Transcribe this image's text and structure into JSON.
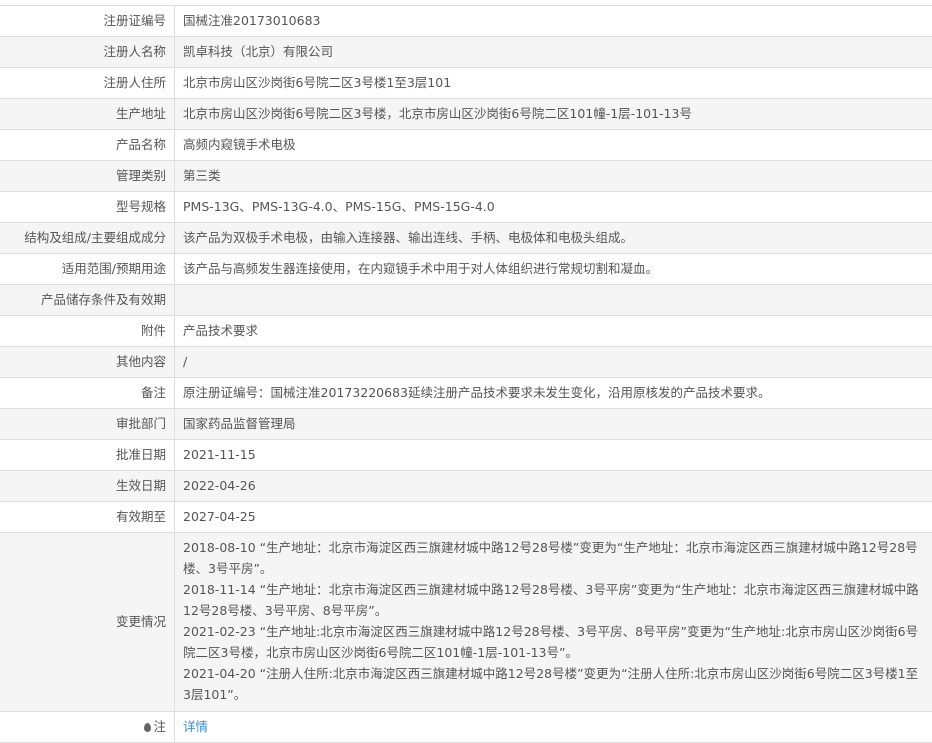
{
  "rows": [
    {
      "label": "注册证编号",
      "value": "国械注准20173010683"
    },
    {
      "label": "注册人名称",
      "value": "凯卓科技（北京）有限公司"
    },
    {
      "label": "注册人住所",
      "value": "北京市房山区沙岗街6号院二区3号楼1至3层101"
    },
    {
      "label": "生产地址",
      "value": "北京市房山区沙岗街6号院二区3号楼，北京市房山区沙岗街6号院二区101幢-1层-101-13号"
    },
    {
      "label": "产品名称",
      "value": "高频内窥镜手术电极"
    },
    {
      "label": "管理类别",
      "value": "第三类"
    },
    {
      "label": "型号规格",
      "value": "PMS-13G、PMS-13G-4.0、PMS-15G、PMS-15G-4.0"
    },
    {
      "label": "结构及组成/主要组成成分",
      "value": "该产品为双极手术电极，由输入连接器、输出连线、手柄、电极体和电极头组成。"
    },
    {
      "label": "适用范围/预期用途",
      "value": "该产品与高频发生器连接使用，在内窥镜手术中用于对人体组织进行常规切割和凝血。"
    },
    {
      "label": "产品储存条件及有效期",
      "value": ""
    },
    {
      "label": "附件",
      "value": "产品技术要求"
    },
    {
      "label": "其他内容",
      "value": "/"
    },
    {
      "label": "备注",
      "value": "原注册证编号：国械注准20173220683延续注册产品技术要求未发生变化，沿用原核发的产品技术要求。"
    },
    {
      "label": "审批部门",
      "value": "国家药品监督管理局"
    },
    {
      "label": "批准日期",
      "value": "2021-11-15"
    },
    {
      "label": "生效日期",
      "value": "2022-04-26"
    },
    {
      "label": "有效期至",
      "value": "2027-04-25"
    }
  ],
  "changes": {
    "label": "变更情况",
    "items": [
      "2018-08-10 “生产地址：北京市海淀区西三旗建材城中路12号28号楼”变更为“生产地址：北京市海淀区西三旗建材城中路12号28号楼、3号平房”。",
      "2018-11-14 “生产地址：北京市海淀区西三旗建材城中路12号28号楼、3号平房”变更为“生产地址：北京市海淀区西三旗建材城中路12号28号楼、3号平房、8号平房”。",
      "2021-02-23 “生产地址:北京市海淀区西三旗建材城中路12号28号楼、3号平房、8号平房”变更为“生产地址:北京市房山区沙岗街6号院二区3号楼，北京市房山区沙岗街6号院二区101幢-1层-101-13号”。",
      "2021-04-20 “注册人住所:北京市海淀区西三旗建材城中路12号28号楼”变更为“注册人住所:北京市房山区沙岗街6号院二区3号楼1至3层101”。"
    ]
  },
  "note": {
    "label": "注",
    "link": "详情"
  }
}
